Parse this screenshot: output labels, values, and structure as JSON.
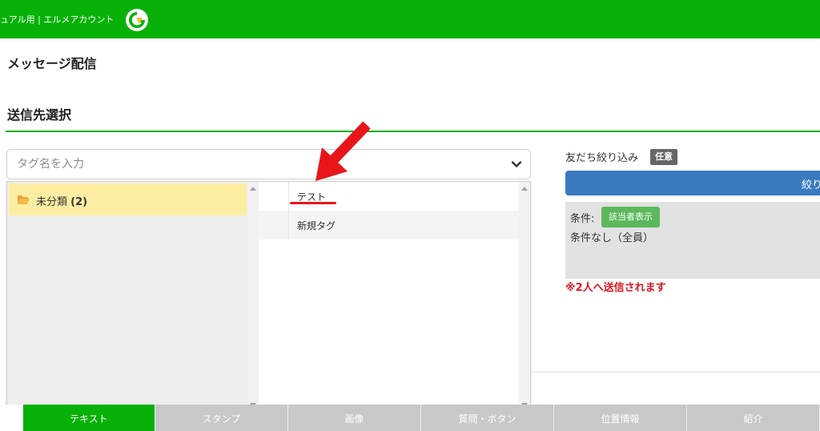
{
  "header": {
    "app_title": "ュアル用 | エルメアカウント",
    "logo_icon": "line-logo-icon",
    "bg_color": "#07b107"
  },
  "page": {
    "title": "メッセージ配信",
    "section_title": "送信先選択"
  },
  "tag_search": {
    "placeholder": "タグ名を入力",
    "dropdown_icon": "chevron-down-icon"
  },
  "tag_folders": [
    {
      "label": "未分類",
      "count": "(2)",
      "icon": "folder-open-icon"
    }
  ],
  "tags": [
    {
      "label": "テスト"
    },
    {
      "label": "新規タグ"
    }
  ],
  "filter": {
    "label": "友だち絞り込み",
    "badge": "任意",
    "button_label": "絞り",
    "condition_label": "条件:",
    "show_button": "該当者表示",
    "condition_value": "条件なし（全員）",
    "send_note": "※2人へ送信されます"
  },
  "message_tabs": [
    {
      "label": "テキスト",
      "active": true
    },
    {
      "label": "スタンプ",
      "active": false
    },
    {
      "label": "画像",
      "active": false
    },
    {
      "label": "質問・ボタン",
      "active": false
    },
    {
      "label": "位置情報",
      "active": false
    },
    {
      "label": "紹介",
      "active": false
    }
  ],
  "colors": {
    "accent_green": "#07b107",
    "annotation_red": "#e8151b",
    "filter_blue": "#3a7bbf",
    "folder_highlight": "#fbeea3"
  }
}
